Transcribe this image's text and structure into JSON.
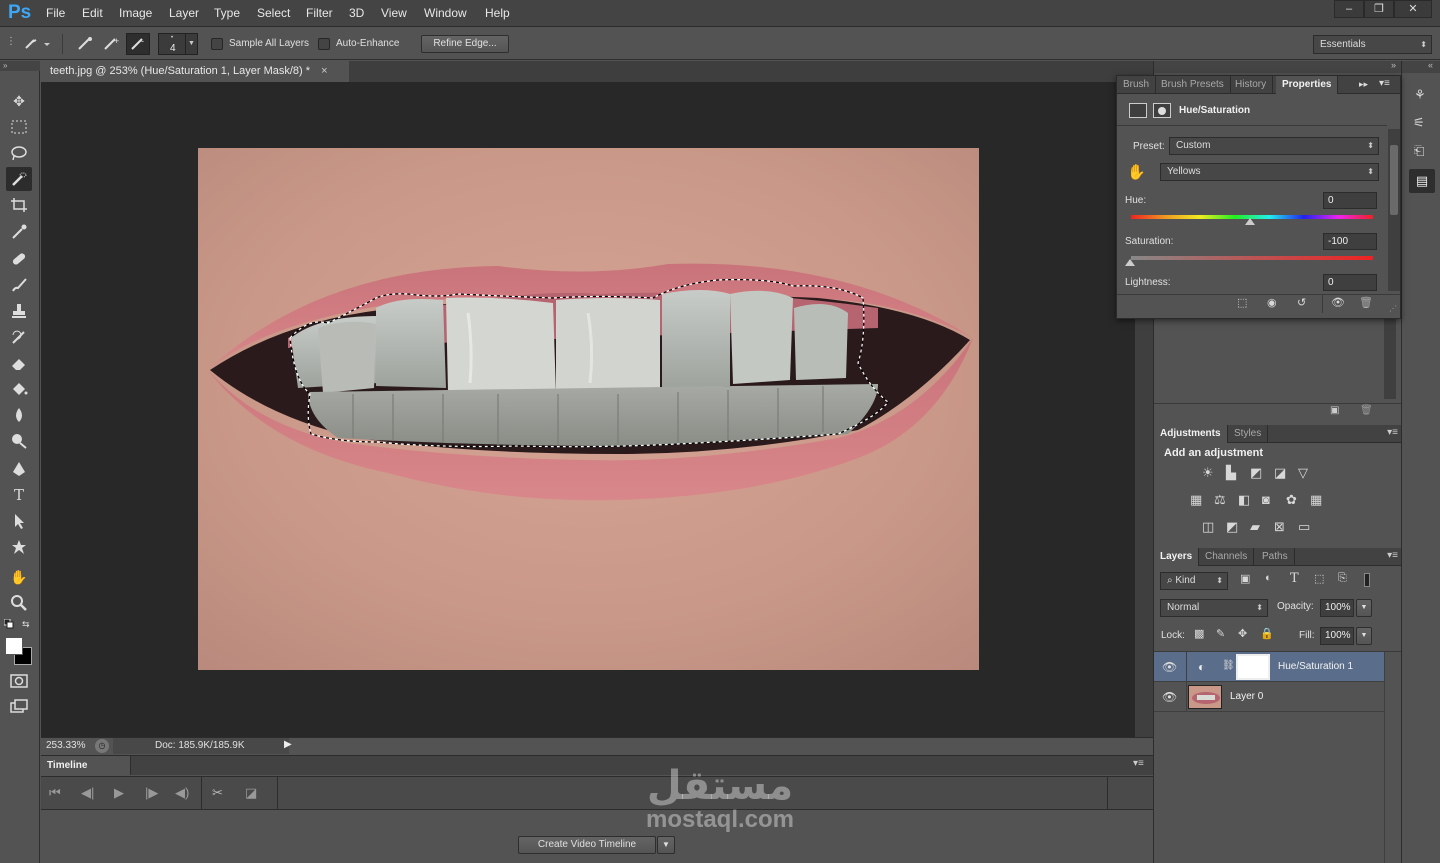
{
  "app": {
    "logo": "Ps",
    "menu": [
      "File",
      "Edit",
      "Image",
      "Layer",
      "Type",
      "Select",
      "Filter",
      "3D",
      "View",
      "Window",
      "Help"
    ],
    "window_buttons": [
      "–",
      "❐",
      "✕"
    ]
  },
  "options_bar": {
    "brush_size": "4",
    "sample_all_layers": "Sample All Layers",
    "auto_enhance": "Auto-Enhance",
    "refine_edge": "Refine Edge...",
    "workspace": "Essentials"
  },
  "document": {
    "tab_title": "teeth.jpg @ 253% (Hue/Saturation 1, Layer Mask/8) *",
    "close": "×",
    "zoom": "253.33%",
    "doc_size": "Doc: 185.9K/185.9K"
  },
  "timeline": {
    "title": "Timeline",
    "create_button": "Create Video Timeline"
  },
  "properties": {
    "tabs": [
      "Brush",
      "Brush Presets",
      "History",
      "Properties"
    ],
    "active_tab": "Properties",
    "title": "Hue/Saturation",
    "preset_label": "Preset:",
    "preset_value": "Custom",
    "channel_value": "Yellows",
    "hue_label": "Hue:",
    "hue_value": "0",
    "saturation_label": "Saturation:",
    "saturation_value": "-100",
    "lightness_label": "Lightness:",
    "lightness_value": "0"
  },
  "adjustments": {
    "tabs": [
      "Adjustments",
      "Styles"
    ],
    "heading": "Add an adjustment"
  },
  "layers": {
    "tabs": [
      "Layers",
      "Channels",
      "Paths"
    ],
    "kind_label": "Kind",
    "blend_mode": "Normal",
    "opacity_label": "Opacity:",
    "opacity_value": "100%",
    "lock_label": "Lock:",
    "fill_label": "Fill:",
    "fill_value": "100%",
    "items": [
      {
        "name": "Hue/Saturation 1",
        "selected": true
      },
      {
        "name": "Layer 0",
        "selected": false
      }
    ]
  },
  "watermark": {
    "arabic": "مستقل",
    "latin": "mostaql.com"
  },
  "colors": {
    "accent_blue": "#3ea7f5",
    "panel_bg": "#535353",
    "canvas_bg": "#282828",
    "selected_layer": "#5a6d8a"
  }
}
